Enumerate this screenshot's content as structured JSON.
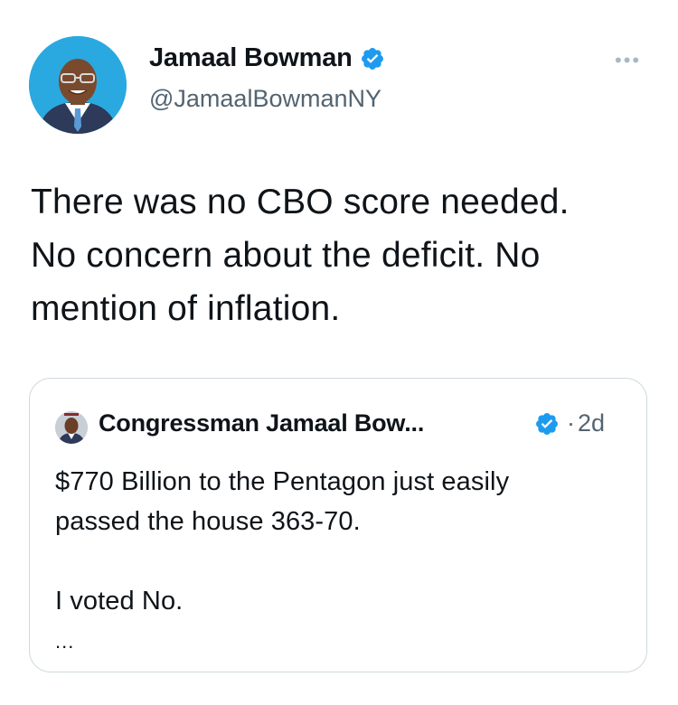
{
  "colors": {
    "accent": "#1d9bf0",
    "text": "#0f1419",
    "secondary": "#536471",
    "border": "#cfd9de"
  },
  "tweet": {
    "author": {
      "name": "Jamaal Bowman",
      "handle": "@JamaalBowmanNY",
      "verified_icon": "verified-badge-icon",
      "avatar_icon": "profile-photo"
    },
    "more_icon": "more-options-icon",
    "text": "There was no CBO score needed.\nNo concern about the deficit. No\nmention of inflation."
  },
  "quote": {
    "author": {
      "name": "Congressman Jamaal Bow...",
      "verified_icon": "verified-badge-icon"
    },
    "separator": "·",
    "time": "2d",
    "text": "$770 Billion to the Pentagon just easily\npassed the house 363-70.\n\nI voted No.",
    "truncation": "..."
  }
}
